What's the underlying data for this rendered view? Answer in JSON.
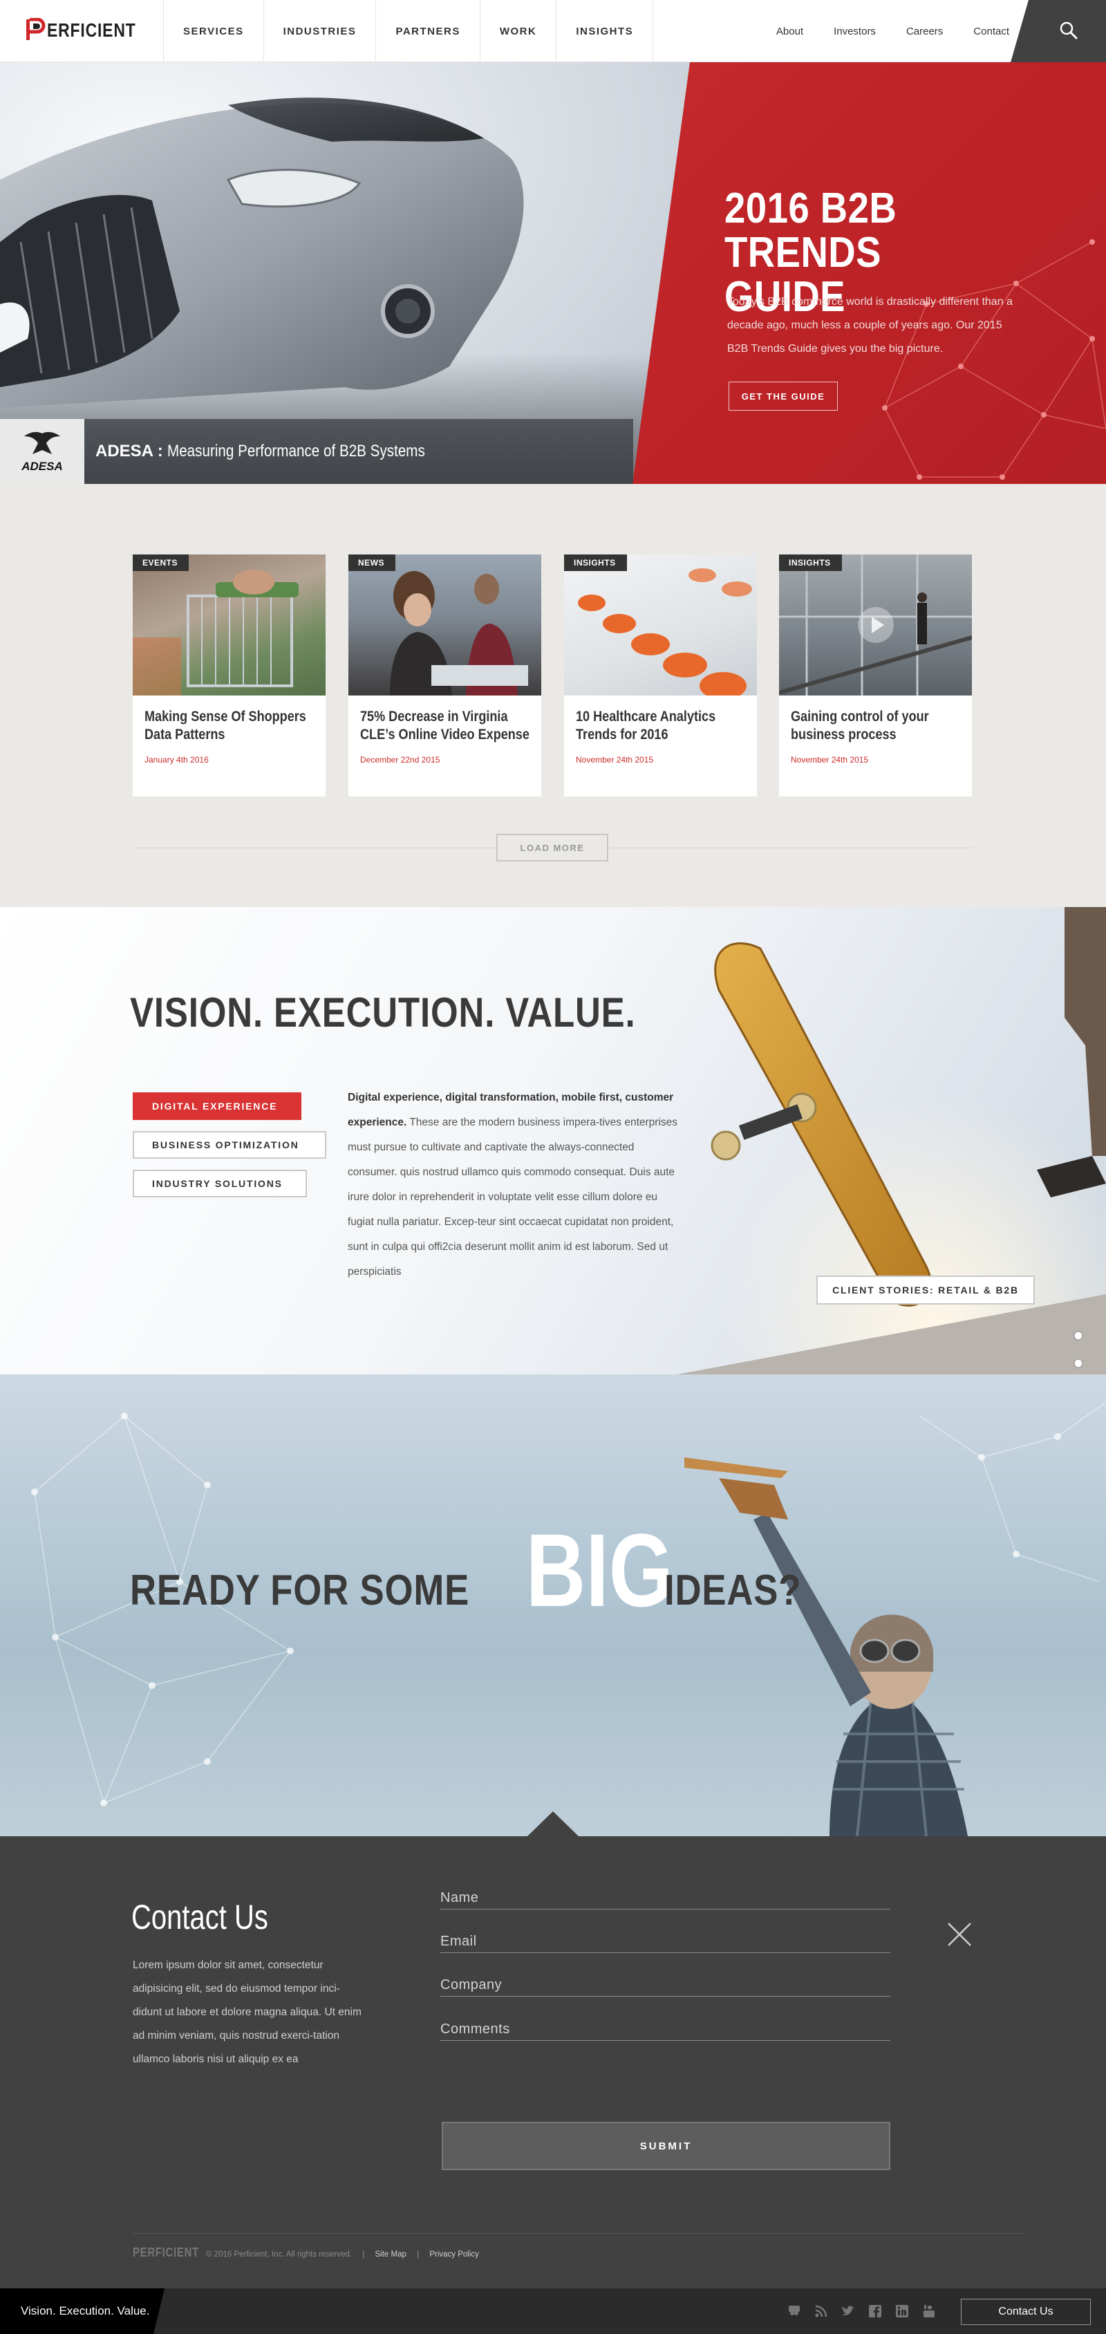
{
  "header": {
    "logo_text": "ERFICIENT",
    "logo_initial": "P",
    "main_nav": [
      "SERVICES",
      "INDUSTRIES",
      "PARTNERS",
      "WORK",
      "INSIGHTS"
    ],
    "utility_nav": [
      "About",
      "Investors",
      "Careers",
      "Contact"
    ],
    "search_icon": "search-icon"
  },
  "hero": {
    "title_line1": "2016 B2B",
    "title_line2": "TRENDS GUIDE",
    "description": "Today’s B2B commerce world is drastically different than a decade ago, much less a couple of years ago. Our 2015 B2B Trends Guide gives you the big picture.",
    "cta": "GET THE GUIDE",
    "caption_brand": "ADESA :",
    "caption_text": "Measuring Performance of B2B Systems",
    "caption_logo": "ADESA",
    "accent_color": "#c8282c"
  },
  "cards": [
    {
      "tag": "EVENTS",
      "title": "Making Sense Of Shoppers Data Patterns",
      "date": "January 4th 2016"
    },
    {
      "tag": "NEWS",
      "title": "75% Decrease in Virginia CLE’s Online Video Expense",
      "date": "December 22nd 2015"
    },
    {
      "tag": "INSIGHTS",
      "title": "10 Healthcare Analytics Trends for 2016",
      "date": "November 24th 2015"
    },
    {
      "tag": "INSIGHTS",
      "title": "Gaining control of your business process",
      "date": "November 24th 2015"
    }
  ],
  "load_more": "LOAD MORE",
  "vision": {
    "heading": "VISION. EXECUTION. VALUE.",
    "buttons": [
      "DIGITAL EXPERIENCE",
      "BUSINESS OPTIMIZATION",
      "INDUSTRY SOLUTIONS"
    ],
    "paragraph_bold": "Digital experience, digital transformation, mobile first, customer experience.",
    "paragraph_rest": " These are the modern business impera-tives enterprises must pursue to cultivate and captivate the always-connected consumer. quis nostrud ullamco quis commodo consequat. Duis aute irure dolor in reprehenderit in voluptate velit esse cillum dolore eu fugiat nulla pariatur. Excep-teur sint occaecat cupidatat non proident, sunt in culpa qui offi2cia deserunt mollit anim id est laborum. Sed ut perspiciatis",
    "client_button": "CLIENT STORIES: RETAIL & B2B"
  },
  "ideas": {
    "before": "READY FOR SOME",
    "big": "BIG",
    "after": "IDEAS?"
  },
  "contact": {
    "heading": "Contact Us",
    "text": "Lorem ipsum dolor sit amet, consectetur adipisicing elit, sed do eiusmod tempor inci-didunt ut labore et dolore magna aliqua. Ut enim ad minim veniam, quis nostrud exerci-tation ullamco laboris nisi ut aliquip ex ea",
    "fields": [
      "Name",
      "Email",
      "Company",
      "Comments"
    ],
    "submit": "SUBMIT"
  },
  "footer": {
    "logo": "PERFICIENT",
    "copyright": "© 2016 Perficient, Inc. All rights reserved.",
    "links": [
      "Site Map",
      "Privacy Policy"
    ]
  },
  "bottom_bar": {
    "tagline": "Vision. Execution. Value.",
    "social_icons": [
      "slideshare-icon",
      "rss-icon",
      "twitter-icon",
      "facebook-icon",
      "linkedin-icon",
      "youtube-icon"
    ],
    "contact_button": "Contact Us"
  }
}
